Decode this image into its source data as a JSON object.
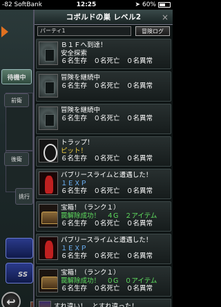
{
  "status": {
    "carrier": "-82 SoftBank",
    "time": "12:25",
    "battery_pct": "60%",
    "battery_level": 0.6
  },
  "background": {
    "wait_tab": "待機中",
    "front_label": "前衛",
    "back_label": "後衛",
    "enter_label": "挑行"
  },
  "log": {
    "title": "コボルドの巣 レベル2",
    "party_select": "パーティ1",
    "log_button": "冒険ログ",
    "entries": [
      {
        "thumb": "dungeon",
        "line1": "Ｂ１Ｆへ到達！",
        "line2": "安全探索",
        "line3": "６名生存　０名死亡　０名異常"
      },
      {
        "thumb": "dungeon",
        "line1": "冒険を継続中",
        "line2": "",
        "line3": "６名生存　０名死亡　０名異常"
      },
      {
        "thumb": "dungeon",
        "line1": "冒険を継続中",
        "line2": "",
        "line3": "６名生存　０名死亡　０名異常"
      },
      {
        "thumb": "trap",
        "line1": "トラップ！",
        "line2": "ピット！",
        "line3": "６名生存　０名死亡　０名異常"
      },
      {
        "thumb": "slime",
        "line1": "バブリースライムと遭遇した！",
        "line2": "１ＥＸＰ",
        "line3": "６名生存　０名死亡　０名異常"
      },
      {
        "thumb": "chest",
        "line1": "宝箱！（ランク１）",
        "line2": "罠解除成功！　４G　２アイテム",
        "line3": "６名生存　０名死亡　０名異常"
      },
      {
        "thumb": "slime",
        "line1": "バブリースライムと遭遇した！",
        "line2": "１ＥＸＰ",
        "line3": "６名生存　０名死亡　０名異常"
      },
      {
        "thumb": "chest",
        "line1": "宝箱！（ランク１）",
        "line2": "罠解除成功！　０G　０アイテム",
        "line3": "６名生存　０名死亡　０名異常"
      }
    ],
    "last_entry": {
      "part1": "すれ違い！",
      "part2": "とすれ違った！"
    }
  }
}
